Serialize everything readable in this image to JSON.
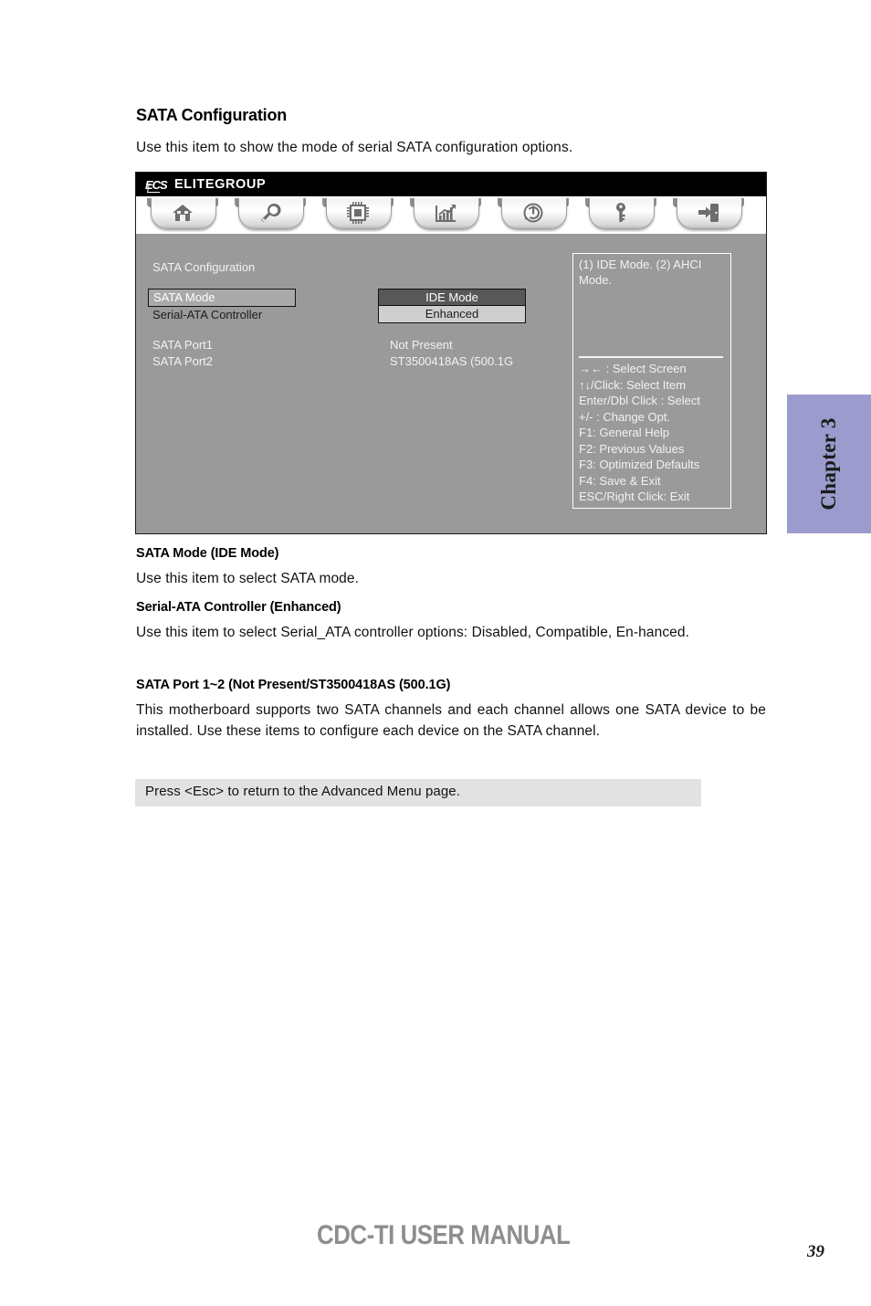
{
  "document": {
    "heading": "SATA Configuration",
    "intro": "Use this item to show the mode of serial SATA configuration options.",
    "chapter_tab": "Chapter 3",
    "sections": [
      {
        "heading": "SATA Mode (IDE Mode)",
        "body": "Use this item to select SATA mode."
      },
      {
        "heading": "Serial-ATA Controller (Enhanced)",
        "body": "Use this item to select Serial_ATA controller options: Disabled, Compatible, En-hanced."
      },
      {
        "heading": "SATA Port 1~2 (Not Present/ST3500418AS    (500.1G)",
        "body": "This motherboard supports two SATA channels and each channel allows one SATA device to be installed. Use these items to configure each device on the SATA channel."
      }
    ],
    "note": "Press <Esc> to return to the Advanced Menu page."
  },
  "bios": {
    "brand_mark": "ECS",
    "brand_name": "ELITEGROUP",
    "tabs": [
      {
        "label": "Main",
        "icon": "home-icon",
        "active": false
      },
      {
        "label": "Advanced",
        "icon": "wrench-icon",
        "active": true
      },
      {
        "label": "Chipset",
        "icon": "chip-icon",
        "active": false
      },
      {
        "label": "Tweak",
        "icon": "chart-icon",
        "active": false
      },
      {
        "label": "Boot",
        "icon": "power-icon",
        "active": false
      },
      {
        "label": "Security",
        "icon": "key-icon",
        "active": false
      },
      {
        "label": "Exit",
        "icon": "exit-icon",
        "active": false
      }
    ],
    "section_title": "SATA Configuration",
    "selected_item": "SATA Mode",
    "option_selected": "IDE Mode",
    "option_secondary": "Enhanced",
    "rows": [
      {
        "label": "Serial-ATA Controller"
      },
      {
        "label": "SATA Port1",
        "value": "Not Present"
      },
      {
        "label": "SATA Port2",
        "value": "ST3500418AS    (500.1G"
      }
    ],
    "help_text": "(1) IDE Mode. (2) AHCI Mode.",
    "help_keys": [
      "→←   : Select Screen",
      "↑↓/Click: Select Item",
      "Enter/Dbl Click : Select",
      "+/- : Change Opt.",
      "F1: General Help",
      "F2: Previous Values",
      "F3: Optimized Defaults",
      "F4: Save & Exit",
      "ESC/Right Click: Exit"
    ]
  },
  "footer": {
    "title": "CDC-TI USER MANUAL",
    "page_number": "39"
  }
}
